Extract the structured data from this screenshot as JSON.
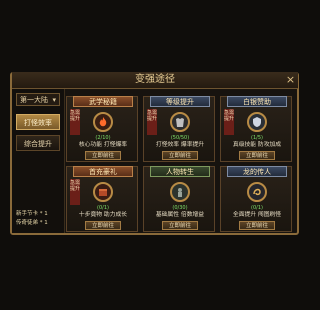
{
  "window": {
    "title": "变强途径",
    "close_label": "×"
  },
  "sidebar": {
    "dropdown_value": "第一大陆",
    "buttons": [
      {
        "label": "打怪效率",
        "active": true
      },
      {
        "label": "综合提升",
        "active": false
      }
    ],
    "notes": [
      "新手节卡 * 1",
      "传奇徒弟 * 1"
    ]
  },
  "cards": [
    {
      "title": "武学秘籍",
      "tag": "急需提升",
      "progress": "(2/10)",
      "desc": "核心功能 打怪爆率",
      "button": "立即前往",
      "icon": "flame-icon"
    },
    {
      "title": "等级提升",
      "tag": "急需提升",
      "progress": "(50/50)",
      "desc": "打怪效率 爆率提升",
      "button": "立即前往",
      "icon": "armor-icon"
    },
    {
      "title": "白银赞助",
      "tag": "急需提升",
      "progress": "(1/5)",
      "desc": "真级技能 防攻加成",
      "button": "立即前往",
      "icon": "shield-icon"
    },
    {
      "title": "首充豪礼",
      "tag": "急需提升",
      "progress": "(0/1)",
      "desc": "十步竟物 助力成长",
      "button": "立即前往",
      "icon": "chest-icon"
    },
    {
      "title": "人物转生",
      "tag": "",
      "progress": "(0/30)",
      "desc": "基础属性 倍数增益",
      "button": "立即前往",
      "icon": "statue-icon"
    },
    {
      "title": "龙的传人",
      "tag": "",
      "progress": "(0/1)",
      "desc": "全面提升 闯图刷怪",
      "button": "立即前往",
      "icon": "dragon-icon"
    }
  ]
}
